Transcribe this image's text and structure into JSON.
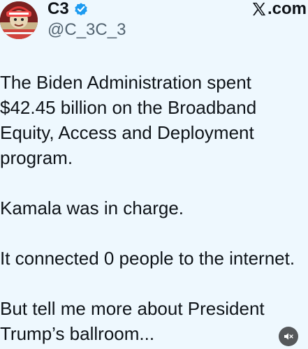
{
  "header": {
    "display_name": "C3",
    "handle": "@C_3C_3",
    "brand_suffix": ".com",
    "verified_color": "#1d9bf0"
  },
  "post": {
    "paragraphs": [
      [
        "The Biden Administration spent",
        "$42.45 billion on the Broadband",
        "Equity, Access and Deployment",
        "program."
      ],
      [
        "Kamala was in charge."
      ],
      [
        "It connected 0 people to the internet."
      ],
      [
        "But tell me more about President",
        "Trump’s ballroom..."
      ]
    ]
  },
  "controls": {
    "mute_icon": "muted-speaker-icon"
  }
}
